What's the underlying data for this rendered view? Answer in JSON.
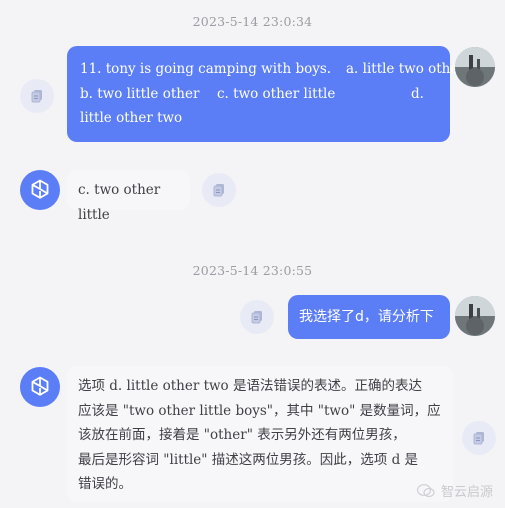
{
  "messages": [
    {
      "timestamp": "2023-5-14 23:0:34",
      "user_lines": [
        [
          "11. tony is going camping with boys.",
          "a. little two other"
        ],
        [
          "b. two little other",
          "c. two other little",
          "d."
        ],
        [
          "little other two"
        ]
      ],
      "bot_text": "c. two other little"
    },
    {
      "timestamp": "2023-5-14 23:0:55",
      "user_text": "我选择了d，请分析下",
      "bot_lines": [
        "选项 d. little other two 是语法错误的表述。正确的表达",
        "应该是 \"two other little boys\"，其中 \"two\" 是数量词，应",
        "该放在前面，接着是 \"other\" 表示另外还有两位男孩，",
        "最后是形容词 \"little\" 描述这两位男孩。因此，选项 d 是",
        "错误的。"
      ]
    }
  ],
  "watermark": {
    "text": "智云启源",
    "icon": "wechat-icon"
  },
  "icons": {
    "copy": "copy-icon",
    "bot": "openai-logo-icon"
  },
  "colors": {
    "accent": "#5b7ef6",
    "background": "#f4f4f6",
    "bot_bubble": "#f7f7f9",
    "copy_button": "#e8ebf6"
  }
}
